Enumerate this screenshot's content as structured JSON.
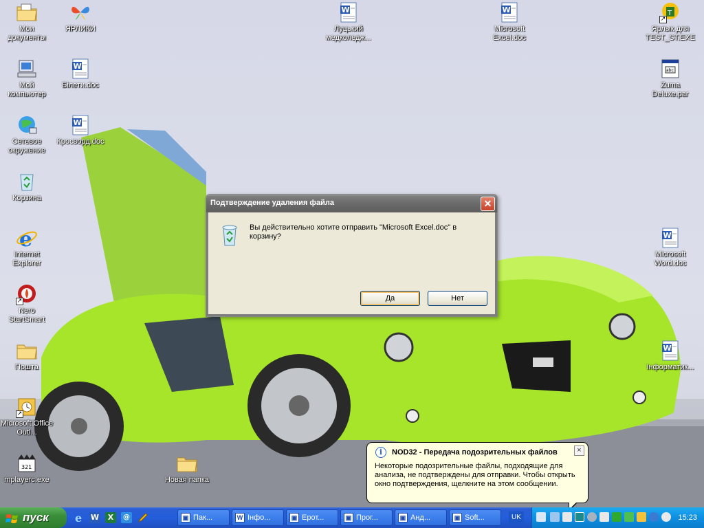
{
  "desktop": {
    "icons_left": [
      {
        "label": "Мои документы",
        "icon": "folder-documents-icon"
      },
      {
        "label": "Мой компьютер",
        "icon": "my-computer-icon"
      },
      {
        "label": "Сетевое окружение",
        "icon": "network-places-icon"
      },
      {
        "label": "Корзина",
        "icon": "recycle-bin-icon"
      },
      {
        "label": "Internet Explorer",
        "icon": "internet-explorer-icon"
      },
      {
        "label": "Nero StartSmart",
        "icon": "nero-icon"
      },
      {
        "label": "Пошта",
        "icon": "folder-icon"
      },
      {
        "label": "Microsoft Office Outl...",
        "icon": "outlook-icon"
      },
      {
        "label": "mplayerc.exe",
        "icon": "media-player-icon"
      }
    ],
    "icons_col2": [
      {
        "label": "ЯРЛИКИ",
        "icon": "butterfly-icon"
      },
      {
        "label": "Білети.doc",
        "icon": "word-document-icon"
      },
      {
        "label": "Кросворд.doc",
        "icon": "word-document-icon"
      }
    ],
    "icons_center": [
      {
        "label": "Луцький медколедж...",
        "icon": "word-document-icon"
      },
      {
        "label": "Microsoft Excel.doc",
        "icon": "word-document-icon"
      }
    ],
    "icons_right": [
      {
        "label": "Ярлык для TEST_ST.EXE",
        "icon": "test-exe-icon"
      },
      {
        "label": "Zuma Deluxe.par",
        "icon": "zuma-file-icon"
      },
      {
        "label": "Microsoft Word.doc",
        "icon": "word-document-icon"
      },
      {
        "label": "Інформатик...",
        "icon": "word-document-icon"
      }
    ],
    "new_folder": {
      "label": "Новая папка",
      "icon": "folder-icon"
    }
  },
  "dialog": {
    "title": "Подтверждение удаления файла",
    "message": "Вы действительно хотите отправить \"Microsoft Excel.doc\" в корзину?",
    "yes_label": "Да",
    "no_label": "Нет",
    "icon": "recycle-bin-icon"
  },
  "balloon": {
    "title": "NOD32 - Передача подозрительных файлов",
    "text": "Некоторые подозрительные файлы, подходящие для анализа, не подтверждены для отправки. Чтобы открыть окно подтверждения, щелкните на этом сообщении.",
    "icon": "info-icon"
  },
  "taskbar": {
    "start_label": "пуск",
    "quicklaunch": [
      "internet-explorer-icon",
      "word-icon",
      "excel-icon",
      "outlook-express-icon",
      "pencil-icon"
    ],
    "tasks": [
      "Пак...",
      "Інфо...",
      "Ерот...",
      "Прог...",
      "Анд...",
      "Soft..."
    ],
    "language": "UK",
    "clock": "15:23"
  },
  "colors": {
    "taskbar_blue": "#245edb",
    "start_green": "#3a8f3a",
    "tray_blue": "#0f8ee0",
    "dialog_bg": "#ece9d8",
    "balloon_bg": "#ffffe1",
    "car_green": "#9fe000"
  }
}
